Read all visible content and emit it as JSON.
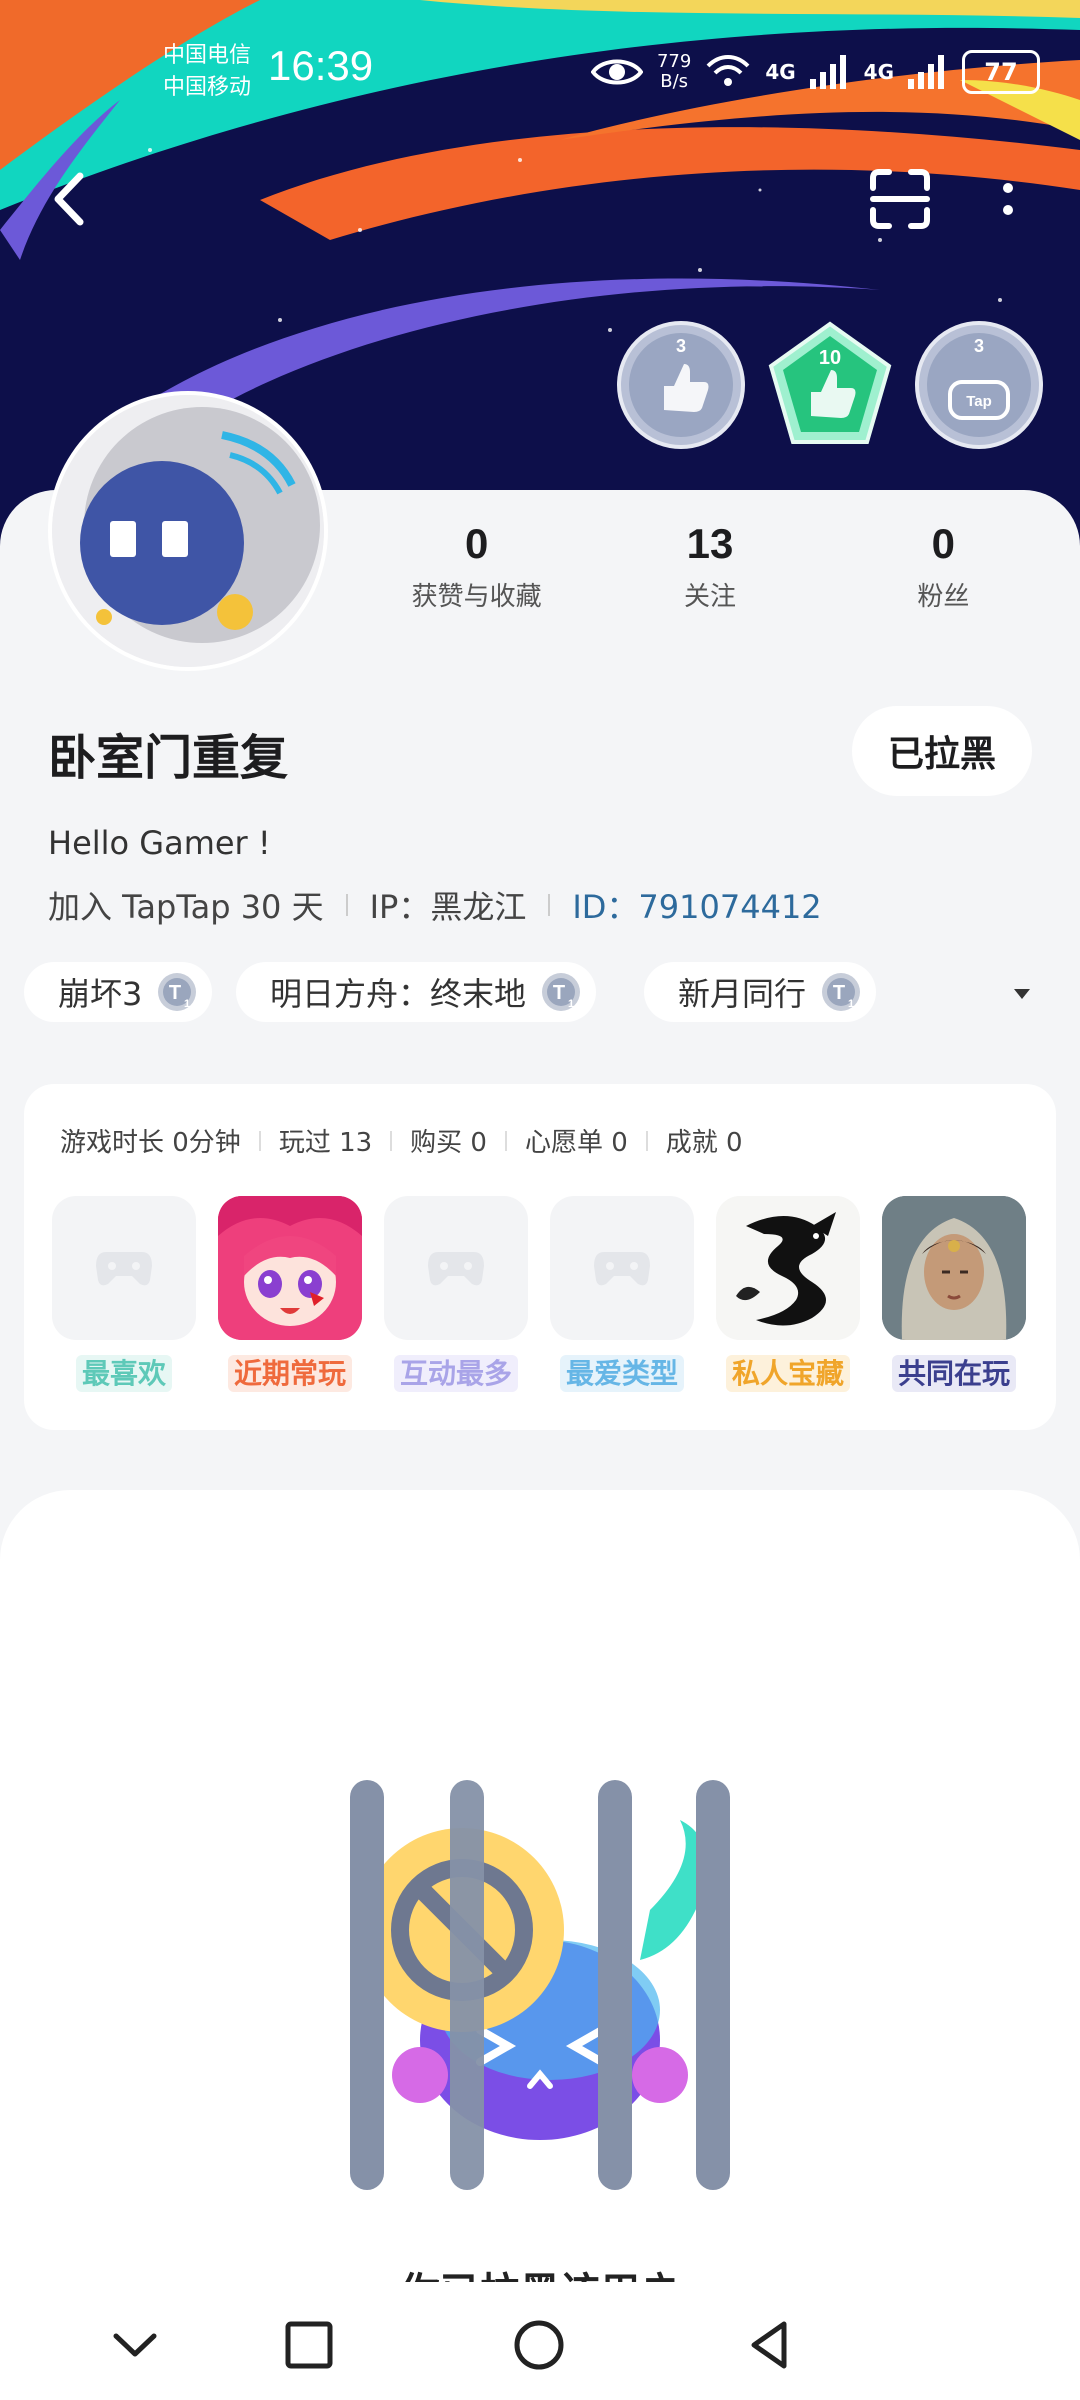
{
  "status_bar": {
    "carrier_1": "中国电信",
    "carrier_2": "中国移动",
    "time": "16:39",
    "net_speed_value": "779",
    "net_speed_unit": "B/s",
    "signal_1": "4G",
    "signal_2": "4G",
    "battery": "77"
  },
  "header": {
    "back_icon": "chevron-left-icon",
    "scan_icon": "scan-icon",
    "more_icon": "more-vertical-icon"
  },
  "badges": [
    {
      "count": "3",
      "icon": "thumbs-up-icon",
      "color": "#9aa6c2"
    },
    {
      "count": "10",
      "icon": "thumbs-up-icon",
      "color": "#26c47e"
    },
    {
      "count": "3",
      "icon": "tap-controller-icon",
      "color": "#9aa6c2"
    }
  ],
  "profile": {
    "stats": [
      {
        "value": "0",
        "label": "获赞与收藏"
      },
      {
        "value": "13",
        "label": "关注"
      },
      {
        "value": "0",
        "label": "粉丝"
      }
    ],
    "username": "卧室门重复",
    "blocked_button": "已拉黑",
    "bio": "Hello Gamer !",
    "joined": "加入 TapTap 30 天",
    "ip": "IP：黑龙江",
    "id": "ID：791074412"
  },
  "tags": [
    {
      "label": "崩坏3",
      "icon": "t1-badge-icon"
    },
    {
      "label": "明日方舟：终末地",
      "icon": "t1-badge-icon"
    },
    {
      "label": "新月同行",
      "icon": "t1-badge-icon"
    }
  ],
  "game_stats": {
    "play_time": "游戏时长 0分钟",
    "played": "玩过 13",
    "purchased": "购买 0",
    "wishlist": "心愿单 0",
    "achievements": "成就 0"
  },
  "games": [
    {
      "label": "最喜欢",
      "color": "#5ec9b8",
      "bg": "#e7f7f4",
      "type": "placeholder"
    },
    {
      "label": "近期常玩",
      "color": "#ef6a3d",
      "bg": "#fde9e1",
      "type": "anime"
    },
    {
      "label": "互动最多",
      "color": "#a9a4e8",
      "bg": "#f0eefc",
      "type": "placeholder"
    },
    {
      "label": "最爱类型",
      "color": "#66b6e6",
      "bg": "#e6f3fb",
      "type": "placeholder"
    },
    {
      "label": "私人宝藏",
      "color": "#f0a52a",
      "bg": "#fdf1db",
      "type": "dragon"
    },
    {
      "label": "共同在玩",
      "color": "#3b3f8e",
      "bg": "#e9e9f6",
      "type": "portrait"
    }
  ],
  "blocked_panel": {
    "illustration": "blocked-character-illustration",
    "message": "你已拉黑该用户"
  },
  "nav": {
    "icons": [
      "chevron-down-icon",
      "square-icon",
      "circle-icon",
      "triangle-back-icon"
    ]
  }
}
